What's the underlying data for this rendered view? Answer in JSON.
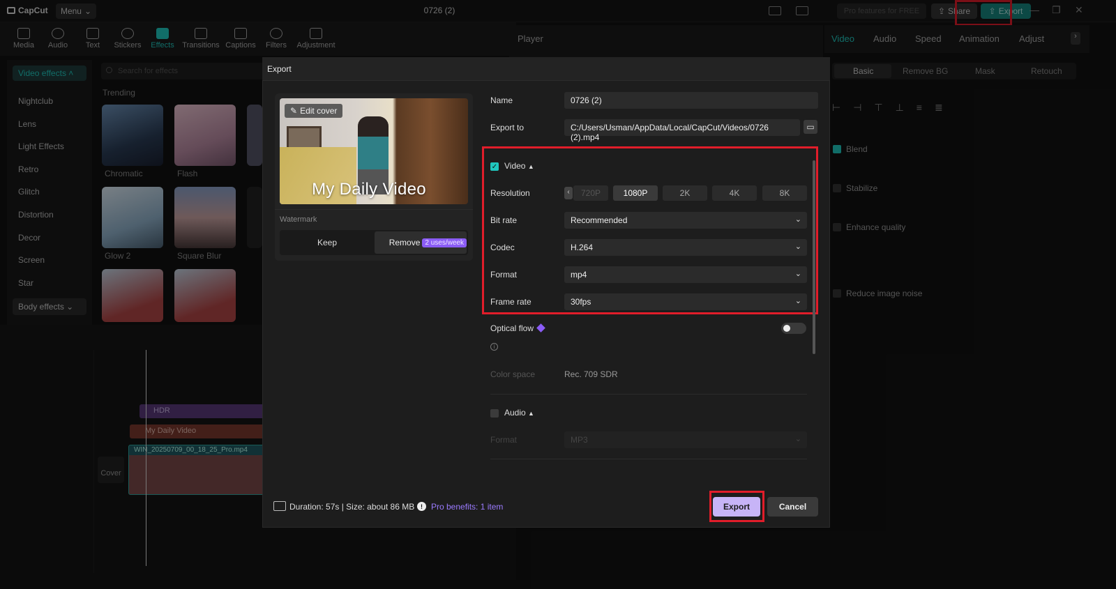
{
  "titlebar": {
    "app_name": "CapCut",
    "menu_label": "Menu",
    "doc_title": "0726 (2)",
    "pro_features": "Pro features for FREE",
    "share_label": "Share",
    "export_label": "Export"
  },
  "toolbar": {
    "items": [
      {
        "label": "Media",
        "icon": "media-icon"
      },
      {
        "label": "Audio",
        "icon": "audio-icon"
      },
      {
        "label": "Text",
        "icon": "text-icon"
      },
      {
        "label": "Stickers",
        "icon": "sticker-icon"
      },
      {
        "label": "Effects",
        "icon": "effects-icon",
        "active": true
      },
      {
        "label": "Transitions",
        "icon": "transitions-icon"
      },
      {
        "label": "Captions",
        "icon": "captions-icon"
      },
      {
        "label": "Filters",
        "icon": "filters-icon"
      },
      {
        "label": "Adjustment",
        "icon": "adjustment-icon"
      }
    ]
  },
  "effects_panel": {
    "nav_header": "Video effects",
    "nav_items": [
      "Nightclub",
      "Lens",
      "Light Effects",
      "Retro",
      "Glitch",
      "Distortion",
      "Decor",
      "Screen",
      "Star"
    ],
    "body_effects": "Body effects",
    "search_placeholder": "Search for effects",
    "trending_label": "Trending",
    "thumbs": [
      "Chromatic",
      "Flash",
      "Glow 2",
      "Square Blur"
    ]
  },
  "player": {
    "title": "Player"
  },
  "right_panel": {
    "tabs": [
      "Video",
      "Audio",
      "Speed",
      "Animation",
      "Adjust"
    ],
    "subtabs": [
      "Basic",
      "Remove BG",
      "Mask",
      "Retouch"
    ],
    "options": [
      "Blend",
      "Stabilize",
      "Enhance quality",
      "Reduce image noise"
    ]
  },
  "timeline": {
    "tracks": {
      "hdr": "HDR",
      "text_clip": "My Daily Video",
      "video_clip": "WIN_20250709_00_18_25_Pro.mp4",
      "cover": "Cover"
    }
  },
  "export_dialog": {
    "title": "Export",
    "edit_cover": "Edit cover",
    "cover_text": "My Daily Video",
    "watermark_label": "Watermark",
    "keep_label": "Keep",
    "remove_label": "Remove",
    "remove_badge": "2 uses/week",
    "name_label": "Name",
    "name_value": "0726 (2)",
    "export_to_label": "Export to",
    "export_to_value": "C:/Users/Usman/AppData/Local/CapCut/Videos/0726 (2).mp4",
    "video_section": "Video",
    "video_checked": true,
    "resolution_label": "Resolution",
    "resolutions": [
      "720P",
      "1080P",
      "2K",
      "4K",
      "8K"
    ],
    "resolution_selected": "1080P",
    "bitrate_label": "Bit rate",
    "bitrate_value": "Recommended",
    "codec_label": "Codec",
    "codec_value": "H.264",
    "format_label": "Format",
    "format_value": "mp4",
    "framerate_label": "Frame rate",
    "framerate_value": "30fps",
    "optical_flow_label": "Optical flow",
    "color_space_label": "Color space",
    "color_space_value": "Rec. 709 SDR",
    "audio_section": "Audio",
    "audio_checked": false,
    "audio_format_label": "Format",
    "audio_format_value": "MP3",
    "footer_info": "Duration: 57s | Size: about 86 MB",
    "pro_benefits": "Pro benefits: 1 item",
    "export_button": "Export",
    "cancel_button": "Cancel"
  },
  "colors": {
    "accent_teal": "#20c7be",
    "highlight_red": "#e11d2a",
    "export_purple": "#c7b4f7",
    "pro_purple": "#8b5cf6"
  }
}
